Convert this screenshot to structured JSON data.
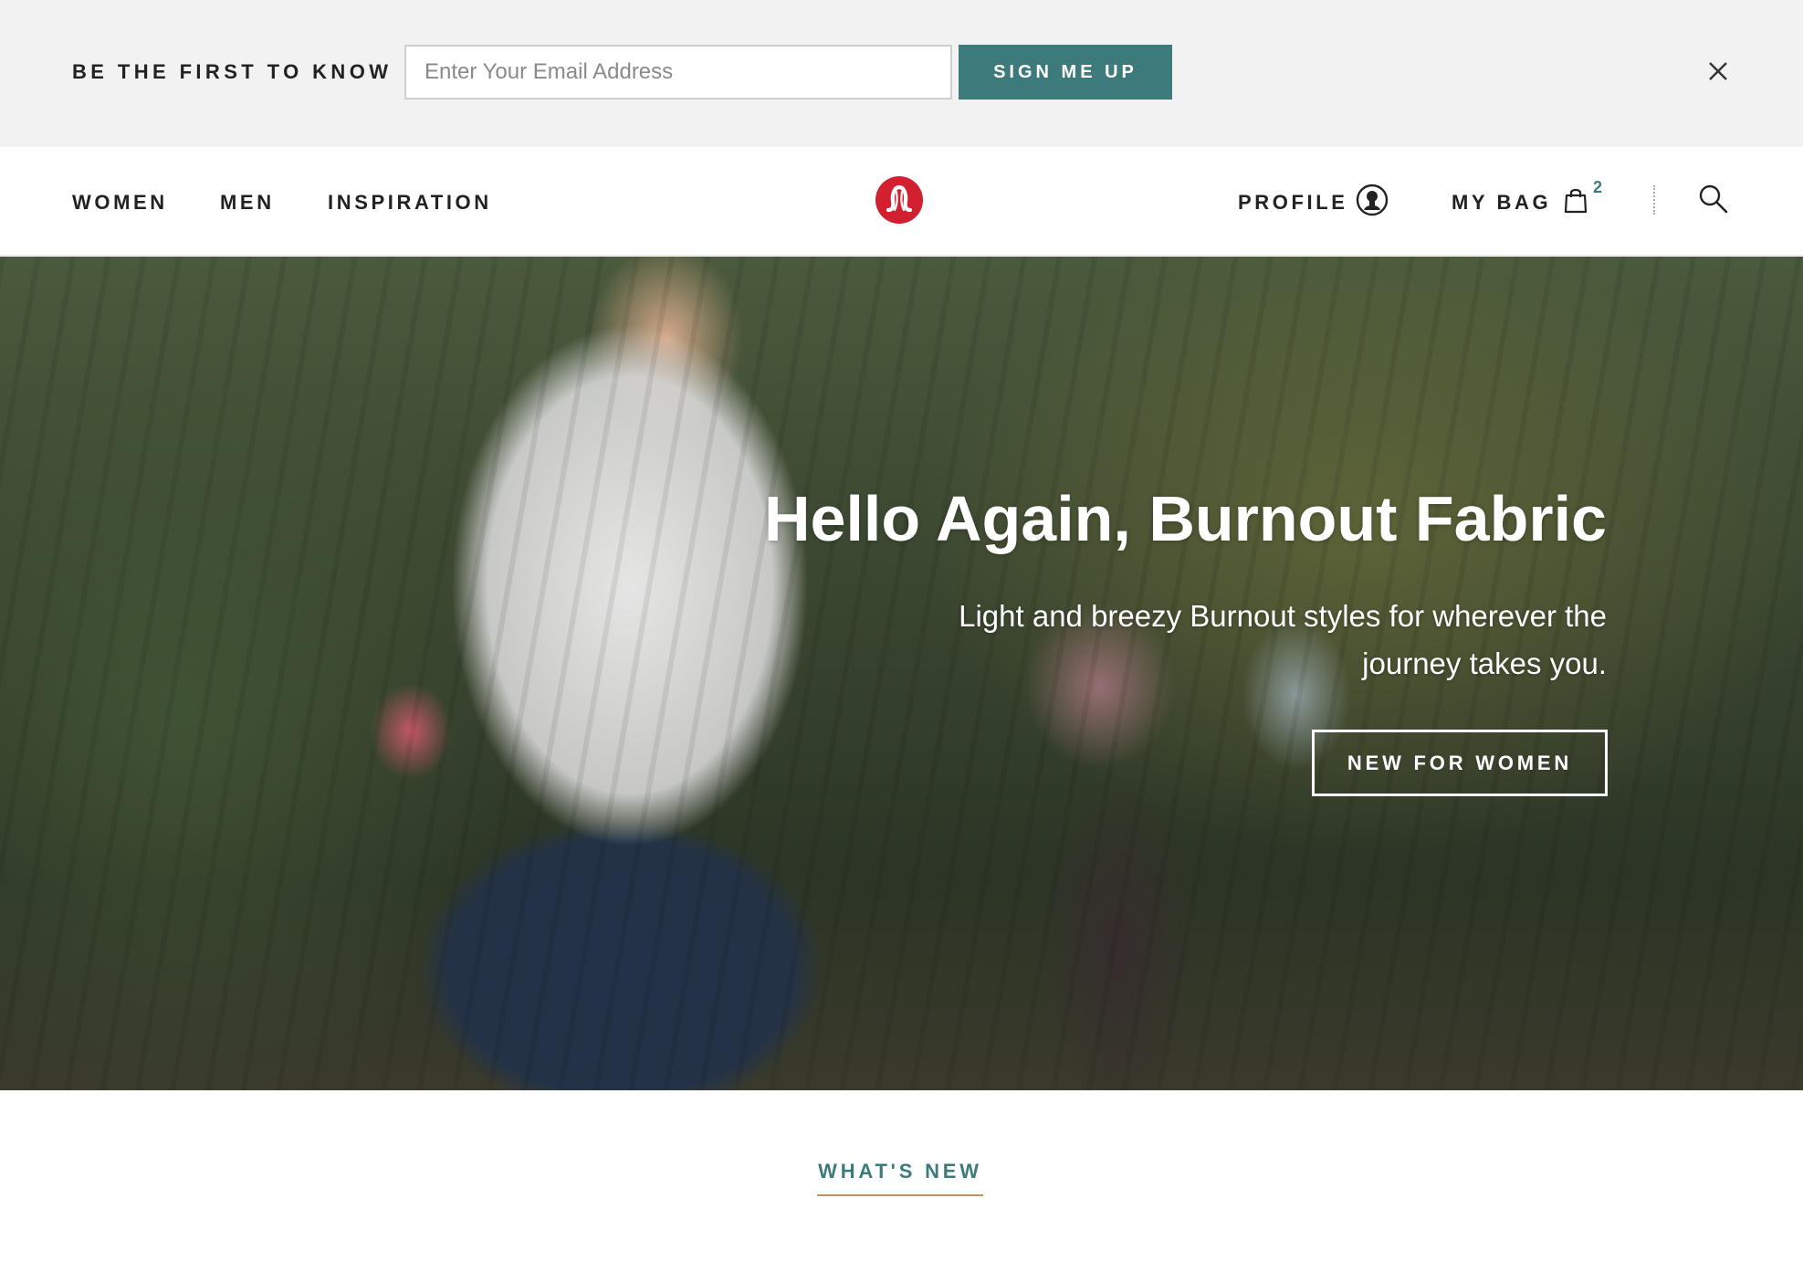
{
  "promo": {
    "title": "BE THE FIRST TO KNOW",
    "email_placeholder": "Enter Your Email Address",
    "email_value": "",
    "signup_label": "SIGN ME UP",
    "close_icon": "close-icon"
  },
  "nav": {
    "links": [
      "WOMEN",
      "MEN",
      "INSPIRATION"
    ],
    "logo_icon": "lululemon-logo",
    "profile_label": "PROFILE",
    "profile_icon": "profile-icon",
    "bag_label": "MY BAG",
    "bag_icon": "shopping-bag-icon",
    "bag_count": "2",
    "search_icon": "search-icon"
  },
  "hero": {
    "title": "Hello Again, Burnout Fabric",
    "subtitle": "Light and breezy Burnout styles for wherever the journey takes you.",
    "cta_label": "NEW FOR WOMEN"
  },
  "section": {
    "whats_new": "WHAT'S NEW"
  },
  "colors": {
    "accent": "#3d7a7c",
    "promo_bg": "#f2f2f2",
    "logo_red": "#d22030",
    "underline": "#b8935a"
  }
}
